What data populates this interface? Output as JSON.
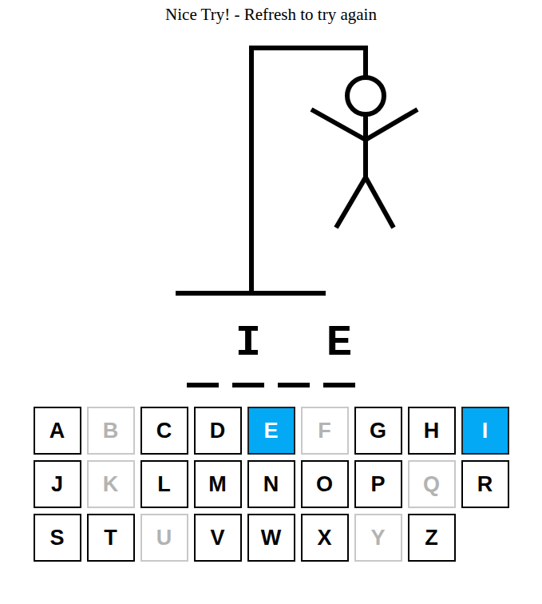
{
  "title": "Nice Try! - Refresh to try again",
  "hangman": {
    "parts": [
      {
        "name": "head",
        "shown": true
      },
      {
        "name": "body",
        "shown": true
      },
      {
        "name": "left-arm",
        "shown": true
      },
      {
        "name": "right-arm",
        "shown": true
      },
      {
        "name": "left-leg",
        "shown": true
      },
      {
        "name": "right-leg",
        "shown": true
      }
    ]
  },
  "word": [
    {
      "letter": "",
      "revealed": false
    },
    {
      "letter": "I",
      "revealed": true
    },
    {
      "letter": "",
      "revealed": false
    },
    {
      "letter": "E",
      "revealed": true
    }
  ],
  "keys": [
    {
      "label": "A",
      "guessed": false,
      "correct": false
    },
    {
      "label": "B",
      "guessed": true,
      "correct": false
    },
    {
      "label": "C",
      "guessed": false,
      "correct": false
    },
    {
      "label": "D",
      "guessed": false,
      "correct": false
    },
    {
      "label": "E",
      "guessed": true,
      "correct": true
    },
    {
      "label": "F",
      "guessed": true,
      "correct": false
    },
    {
      "label": "G",
      "guessed": false,
      "correct": false
    },
    {
      "label": "H",
      "guessed": false,
      "correct": false
    },
    {
      "label": "I",
      "guessed": true,
      "correct": true
    },
    {
      "label": "J",
      "guessed": false,
      "correct": false
    },
    {
      "label": "K",
      "guessed": true,
      "correct": false
    },
    {
      "label": "L",
      "guessed": false,
      "correct": false
    },
    {
      "label": "M",
      "guessed": false,
      "correct": false
    },
    {
      "label": "N",
      "guessed": false,
      "correct": false
    },
    {
      "label": "O",
      "guessed": false,
      "correct": false
    },
    {
      "label": "P",
      "guessed": false,
      "correct": false
    },
    {
      "label": "Q",
      "guessed": true,
      "correct": false
    },
    {
      "label": "R",
      "guessed": false,
      "correct": false
    },
    {
      "label": "S",
      "guessed": false,
      "correct": false
    },
    {
      "label": "T",
      "guessed": false,
      "correct": false
    },
    {
      "label": "U",
      "guessed": true,
      "correct": false
    },
    {
      "label": "V",
      "guessed": false,
      "correct": false
    },
    {
      "label": "W",
      "guessed": false,
      "correct": false
    },
    {
      "label": "X",
      "guessed": false,
      "correct": false
    },
    {
      "label": "Y",
      "guessed": true,
      "correct": false
    },
    {
      "label": "Z",
      "guessed": false,
      "correct": false
    }
  ]
}
